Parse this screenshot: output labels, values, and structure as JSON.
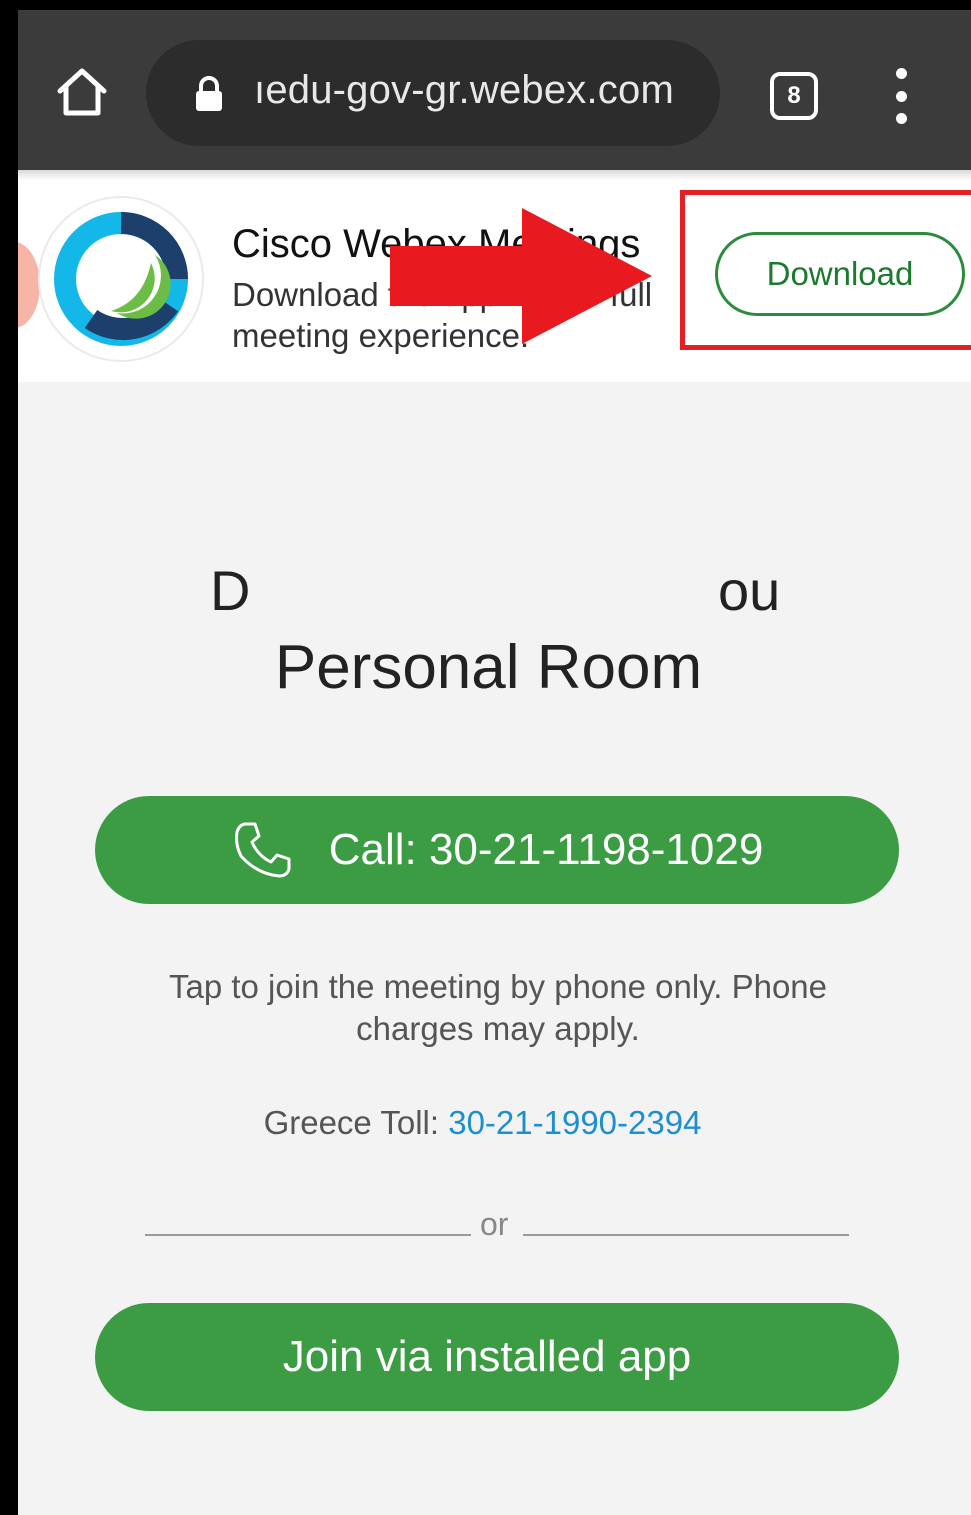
{
  "browser": {
    "url": "ıedu-gov-gr.webex.com",
    "tab_count": "8",
    "icons": [
      "home-icon",
      "lock-icon",
      "tabs-icon",
      "overflow-menu-icon"
    ]
  },
  "banner": {
    "app_title": "Cisco Webex Meetings",
    "app_description": "Download the app for the full meeting experience.",
    "download_label": "Download",
    "colors": {
      "highlight": "#e32026",
      "arrow": "#e8191f",
      "download_green": "#1b7a2c"
    }
  },
  "main": {
    "heading_left_fragment": "D",
    "heading_right_fragment": "ou",
    "heading_line2": "Personal Room",
    "call_button_label": "Call: 30-21-1198-1029",
    "phone_note": "Tap to join the meeting by phone only. Phone charges may apply.",
    "toll_label": "Greece Toll: ",
    "toll_number": "30-21-1990-2394",
    "or_label": "or",
    "join_button_label": "Join via installed app",
    "colors": {
      "button_green": "#3c9c44",
      "link_blue": "#1d8fd0"
    }
  }
}
